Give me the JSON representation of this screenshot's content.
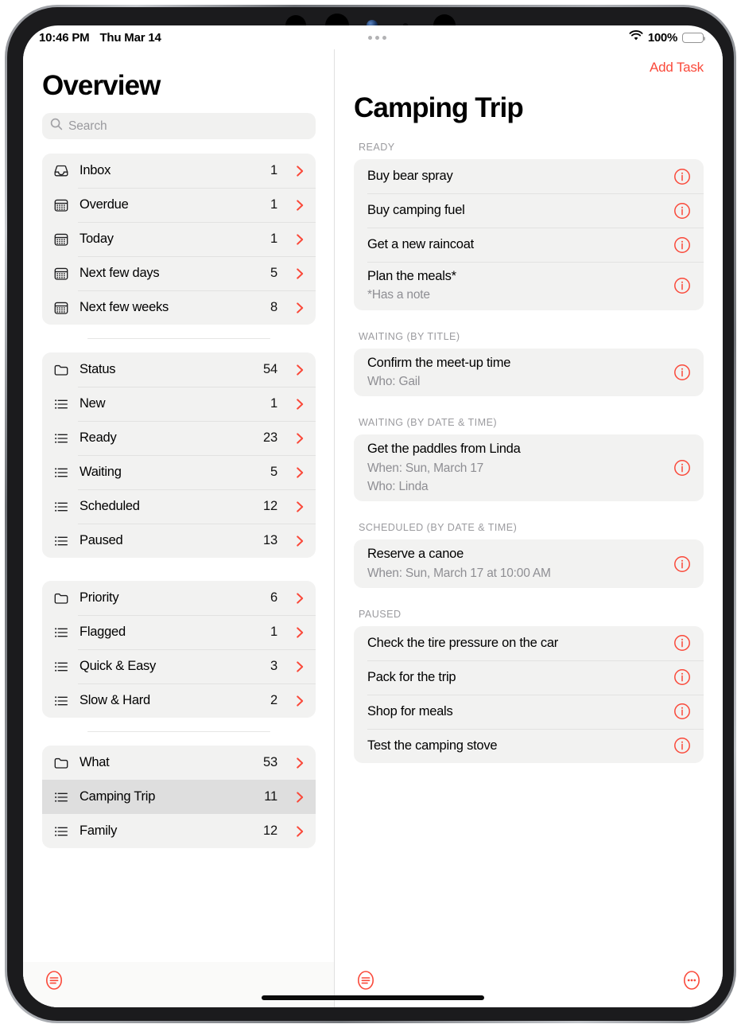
{
  "accent_color": "#fa493a",
  "status_bar": {
    "time": "10:46 PM",
    "date": "Thu Mar 14",
    "multitask_icon": "more-horizontal-icon",
    "wifi_icon": "wifi-icon",
    "battery_percent": "100%",
    "battery_icon": "battery-full-icon"
  },
  "sidebar": {
    "title": "Overview",
    "search": {
      "placeholder": "Search",
      "value": "",
      "icon": "search-icon"
    },
    "groups": [
      {
        "divider_after": true,
        "items": [
          {
            "icon": "inbox-tray-icon",
            "label": "Inbox",
            "count": "1",
            "selected": false
          },
          {
            "icon": "calendar-icon",
            "label": "Overdue",
            "count": "1",
            "selected": false
          },
          {
            "icon": "calendar-icon",
            "label": "Today",
            "count": "1",
            "selected": false
          },
          {
            "icon": "calendar-icon",
            "label": "Next few days",
            "count": "5",
            "selected": false
          },
          {
            "icon": "calendar-icon",
            "label": "Next few weeks",
            "count": "8",
            "selected": false
          }
        ]
      },
      {
        "divider_after": false,
        "items": [
          {
            "icon": "folder-icon",
            "label": "Status",
            "count": "54",
            "selected": false
          },
          {
            "icon": "list-icon",
            "label": "New",
            "count": "1",
            "selected": false
          },
          {
            "icon": "list-icon",
            "label": "Ready",
            "count": "23",
            "selected": false
          },
          {
            "icon": "list-icon",
            "label": "Waiting",
            "count": "5",
            "selected": false
          },
          {
            "icon": "list-icon",
            "label": "Scheduled",
            "count": "12",
            "selected": false
          },
          {
            "icon": "list-icon",
            "label": "Paused",
            "count": "13",
            "selected": false
          }
        ]
      },
      {
        "divider_after": true,
        "items": [
          {
            "icon": "folder-icon",
            "label": "Priority",
            "count": "6",
            "selected": false
          },
          {
            "icon": "list-icon",
            "label": "Flagged",
            "count": "1",
            "selected": false
          },
          {
            "icon": "list-icon",
            "label": "Quick & Easy",
            "count": "3",
            "selected": false
          },
          {
            "icon": "list-icon",
            "label": "Slow & Hard",
            "count": "2",
            "selected": false
          }
        ]
      },
      {
        "divider_after": false,
        "items": [
          {
            "icon": "folder-icon",
            "label": "What",
            "count": "53",
            "selected": false
          },
          {
            "icon": "list-icon",
            "label": "Camping Trip",
            "count": "11",
            "selected": true
          },
          {
            "icon": "list-icon",
            "label": "Family",
            "count": "12",
            "selected": false
          }
        ]
      }
    ]
  },
  "detail": {
    "add_task_label": "Add Task",
    "title": "Camping Trip",
    "sections": [
      {
        "header": "READY",
        "tasks": [
          {
            "title": "Buy bear spray",
            "sublines": [],
            "info_icon": "info-circle-icon"
          },
          {
            "title": "Buy camping fuel",
            "sublines": [],
            "info_icon": "info-circle-icon"
          },
          {
            "title": "Get a new raincoat",
            "sublines": [],
            "info_icon": "info-circle-icon"
          },
          {
            "title": "Plan the meals*",
            "sublines": [
              "*Has a note"
            ],
            "info_icon": "info-circle-icon"
          }
        ]
      },
      {
        "header": "WAITING (BY TITLE)",
        "tasks": [
          {
            "title": "Confirm the meet-up time",
            "sublines": [
              "Who: Gail"
            ],
            "info_icon": "info-circle-icon"
          }
        ]
      },
      {
        "header": "WAITING (BY DATE & TIME)",
        "tasks": [
          {
            "title": "Get the paddles from Linda",
            "sublines": [
              "When: Sun, March 17",
              "Who: Linda"
            ],
            "info_icon": "info-circle-icon"
          }
        ]
      },
      {
        "header": "SCHEDULED (BY DATE & TIME)",
        "tasks": [
          {
            "title": "Reserve a canoe",
            "sublines": [
              "When: Sun, March 17 at 10:00 AM"
            ],
            "info_icon": "info-circle-icon"
          }
        ]
      },
      {
        "header": "PAUSED",
        "tasks": [
          {
            "title": "Check the tire pressure on the car",
            "sublines": [],
            "info_icon": "info-circle-icon"
          },
          {
            "title": "Pack for the trip",
            "sublines": [],
            "info_icon": "info-circle-icon"
          },
          {
            "title": "Shop for meals",
            "sublines": [],
            "info_icon": "info-circle-icon"
          },
          {
            "title": "Test the camping stove",
            "sublines": [],
            "info_icon": "info-circle-icon"
          }
        ]
      }
    ]
  },
  "toolbar": {
    "sidebar_menu_icon": "list-menu-circle-icon",
    "detail_menu_icon": "list-menu-circle-icon",
    "detail_more_icon": "more-circle-icon"
  }
}
